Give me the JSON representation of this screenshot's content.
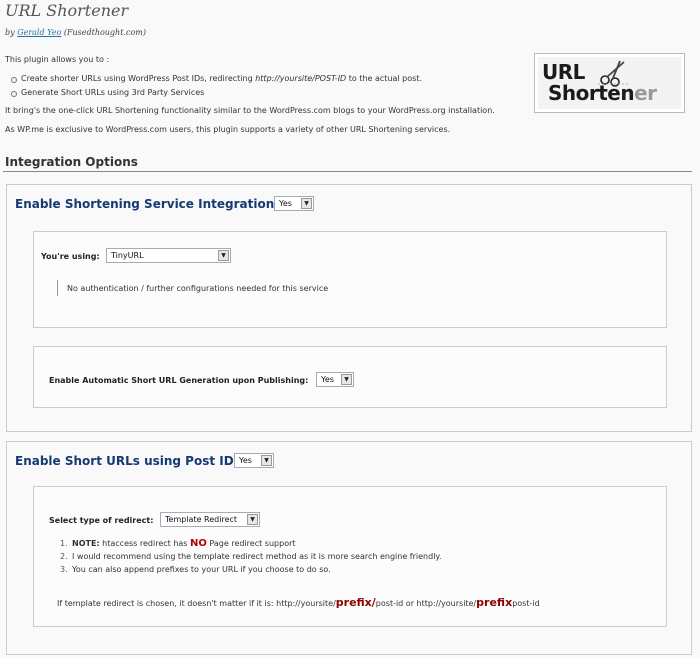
{
  "header": {
    "title": "URL Shortener",
    "by_prefix": "by",
    "author": "Gerald Yeo",
    "author_site": "(Fusedthought.com)"
  },
  "intro": {
    "lead": "This plugin allows you to :",
    "bullets": [
      {
        "pre": "Create shorter URLs using WordPress Post IDs, redirecting ",
        "em": "http://yoursite/POST-ID",
        "post": " to the actual post."
      },
      {
        "pre": "Generate Short URLs using 3rd Party Services",
        "em": "",
        "post": ""
      }
    ],
    "para1": "It bring's the one-click URL Shortening functionality similar to the WordPress.com blogs to your WordPress.org installation.",
    "para2": "As WP.me is exclusive to WordPress.com users, this plugin supports a variety of other URL Shortening services."
  },
  "logo": {
    "line1": "URL",
    "line2_a": "Shorten",
    "line2_b": "er"
  },
  "integration": {
    "heading": "Integration Options"
  },
  "service_panel": {
    "title": "Enable Shortening Service Integration:",
    "enable_value": "Yes",
    "using_label": "You're using:",
    "service_value": "TinyURL",
    "note": "No authentication / further configurations needed for this service",
    "auto_label": "Enable Automatic Short URL Generation upon Publishing:",
    "auto_value": "Yes"
  },
  "postid_panel": {
    "title": "Enable Short URLs using Post ID:",
    "enable_value": "Yes",
    "redirect_label": "Select type of redirect:",
    "redirect_value": "Template Redirect",
    "notes": [
      {
        "num": "1.",
        "bold": "NOTE:",
        "pre": " htaccess redirect has ",
        "no": "NO",
        "post": " Page redirect support"
      },
      {
        "num": "2.",
        "text": "I would recommend using the template redirect method as it is more search engine friendly."
      },
      {
        "num": "3.",
        "text": "You can also append prefixes to your URL if you choose to do so."
      }
    ],
    "template_line": {
      "pre": "If template redirect is chosen, it doesn't matter if it is: http://yoursite/",
      "prefix1": "prefix/",
      "mid": "post-id or http://yoursite/",
      "prefix2": "prefix",
      "post": "post-id"
    }
  }
}
